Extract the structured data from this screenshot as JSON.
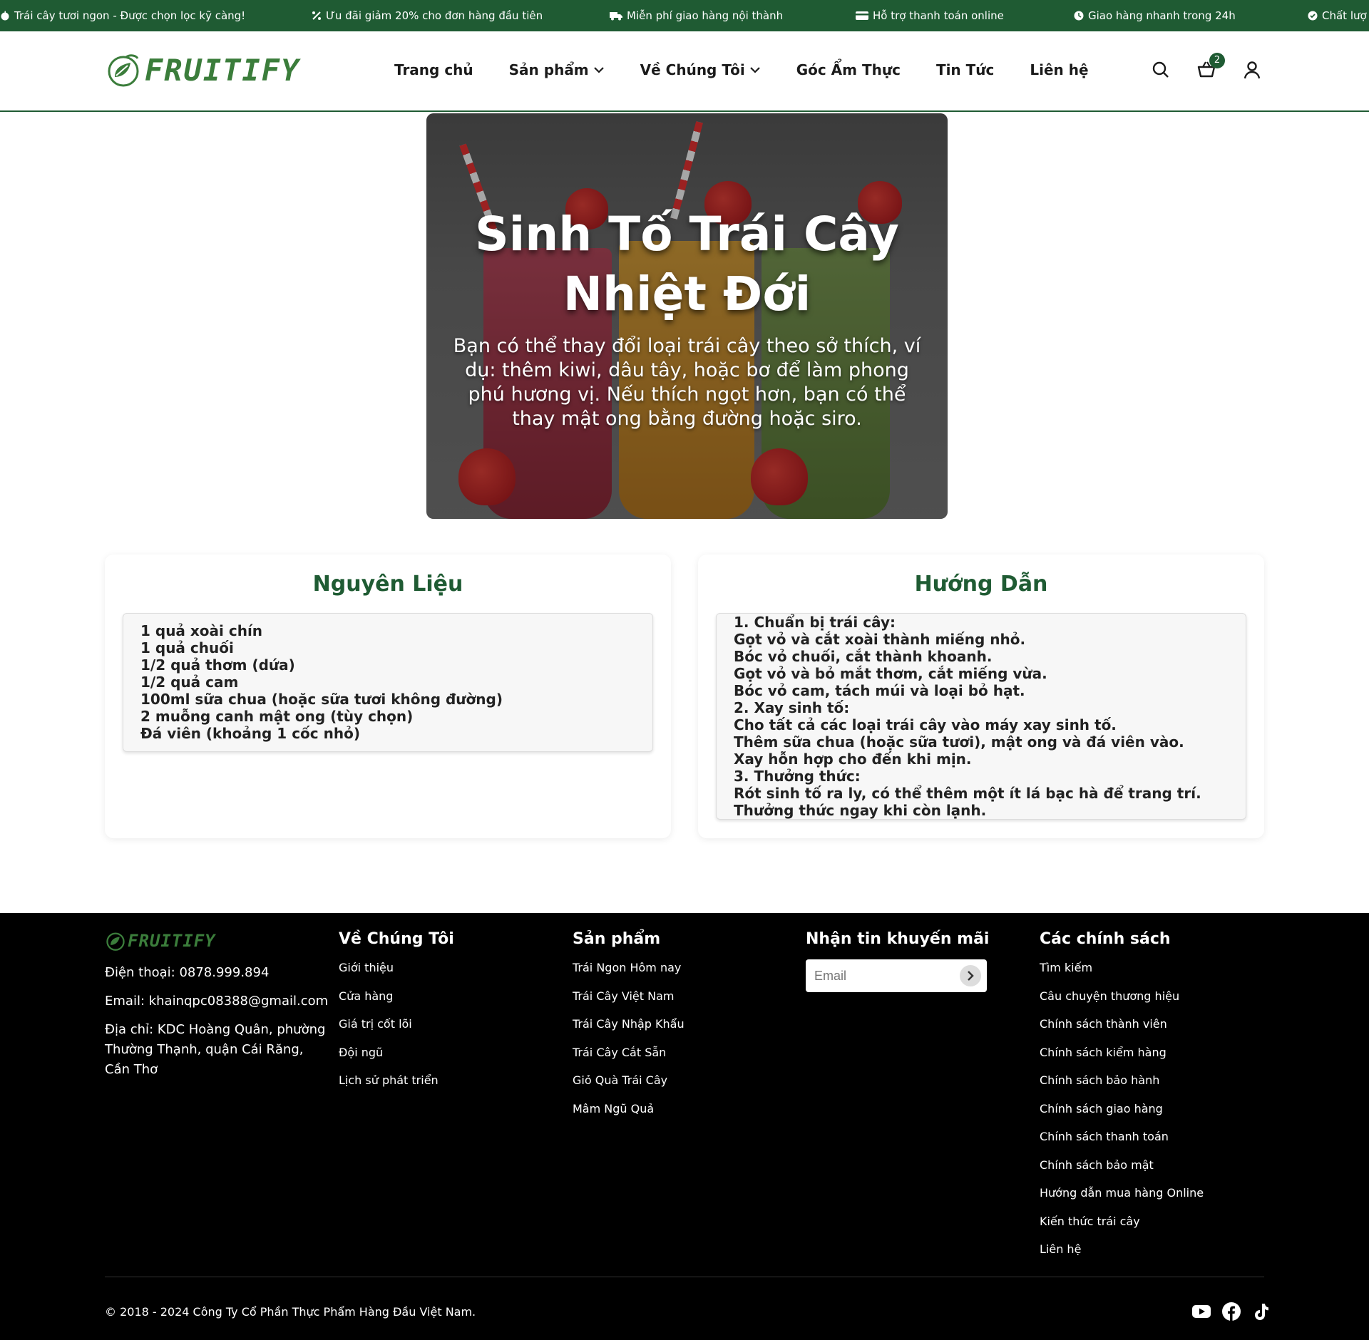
{
  "topbar": {
    "messages": [
      "Trái cây tươi ngon - Được chọn lọc kỹ càng!",
      "Ưu đãi giảm 20% cho đơn hàng đầu tiên",
      "Miễn phí giao hàng nội thành",
      "Hỗ trợ thanh toán online",
      "Giao hàng nhanh trong 24h",
      "Chất lượ"
    ]
  },
  "header": {
    "logo_text": "FRUITIFY",
    "nav": [
      "Trang chủ",
      "Sản phẩm",
      "Về Chúng Tôi",
      "Góc Ẩm Thực",
      "Tin Tức",
      "Liên hệ"
    ],
    "cart_count": "2"
  },
  "hero": {
    "title_line1": "Sinh Tố Trái Cây",
    "title_line2": "Nhiệt Đới",
    "description": "Bạn có thể thay đổi loại trái cây theo sở thích, ví dụ: thêm kiwi, dâu tây, hoặc bơ để làm phong phú hương vị. Nếu thích ngọt hơn, bạn có thể thay mật ong bằng đường hoặc siro."
  },
  "ingredients": {
    "title": "Nguyên Liệu",
    "items": [
      "1 quả xoài chín",
      "1 quả chuối",
      "1/2 quả thơm (dứa)",
      "1/2 quả cam",
      "100ml sữa chua (hoặc sữa tươi không đường)",
      "2 muỗng canh mật ong (tùy chọn)",
      "Đá viên (khoảng 1 cốc nhỏ)"
    ]
  },
  "instructions": {
    "title": "Hướng Dẫn",
    "lines": [
      "1. Chuẩn bị trái cây:",
      "Gọt vỏ và cắt xoài thành miếng nhỏ.",
      "Bóc vỏ chuối, cắt thành khoanh.",
      "Gọt vỏ và bỏ mắt thơm, cắt miếng vừa.",
      "Bóc vỏ cam, tách múi và loại bỏ hạt.",
      "2. Xay sinh tố:",
      "Cho tất cả các loại trái cây vào máy xay sinh tố.",
      "Thêm sữa chua (hoặc sữa tươi), mật ong và đá viên vào.",
      "Xay hỗn hợp cho đến khi mịn.",
      "3. Thưởng thức:",
      "Rót sinh tố ra ly, có thể thêm một ít lá bạc hà để trang trí.",
      "Thưởng thức ngay khi còn lạnh."
    ]
  },
  "footer": {
    "logo_text": "FRUITIFY",
    "phone": "Điện thoại: 0878.999.894",
    "email": "Email: khainqpc08388@gmail.com",
    "address": "Địa chỉ: KDC Hoàng Quân, phường Thường Thạnh, quận Cái Răng, Cần Thơ",
    "about": {
      "title": "Về Chúng Tôi",
      "links": [
        "Giới thiệu",
        "Cửa hàng",
        "Giá trị cốt lõi",
        "Đội ngũ",
        "Lịch sử phát triển"
      ]
    },
    "products": {
      "title": "Sản phẩm",
      "links": [
        "Trái Ngon Hôm nay",
        "Trái Cây Việt Nam",
        "Trái Cây Nhập Khẩu",
        "Trái Cây Cắt Sẵn",
        "Giỏ Quà Trái Cây",
        "Mâm Ngũ Quả"
      ]
    },
    "newsletter": {
      "title": "Nhận tin khuyến mãi",
      "placeholder": "Email"
    },
    "policies": {
      "title": "Các chính sách",
      "links": [
        "Tìm kiếm",
        "Câu chuyện thương hiệu",
        "Chính sách thành viên",
        "Chính sách kiểm hàng",
        "Chính sách bảo hành",
        "Chính sách giao hàng",
        "Chính sách thanh toán",
        "Chính sách bảo mật",
        "Hướng dẫn mua hàng Online",
        "Kiến thức trái cây",
        "Liên hệ"
      ]
    },
    "copyright": "© 2018 - 2024 Công Ty Cổ Phần Thực Phẩm Hàng Đầu Việt Nam."
  },
  "colors": {
    "brand_green": "#1f5b33",
    "logo_green": "#3b7d3b"
  }
}
